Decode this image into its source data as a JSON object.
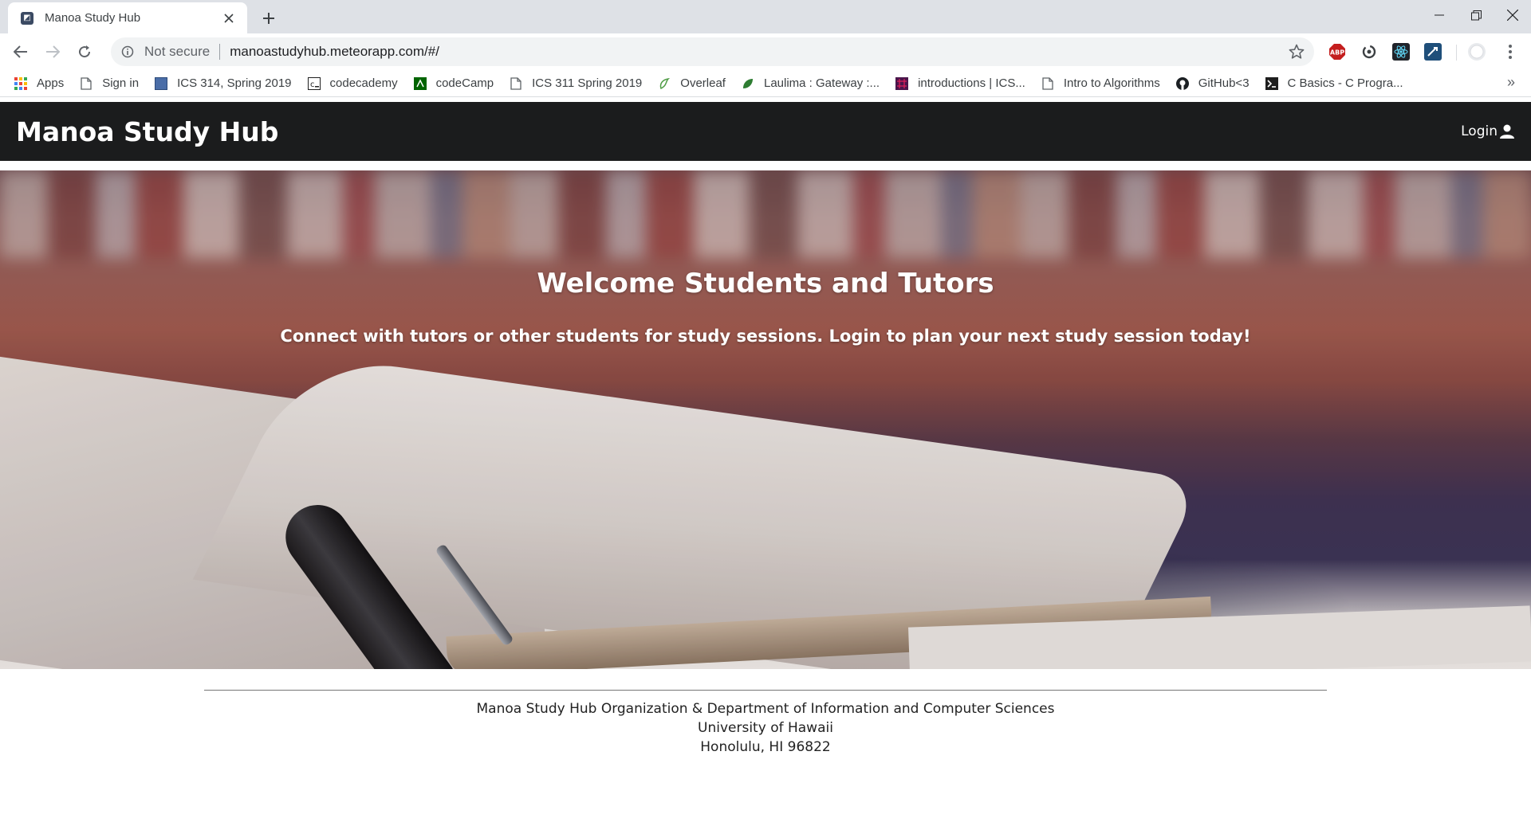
{
  "browser": {
    "tab_title": "Manoa Study Hub",
    "security_label": "Not secure",
    "url": "manoastudyhub.meteorapp.com/#/",
    "bookmarks": [
      {
        "label": "Apps",
        "icon": "apps-grid-icon"
      },
      {
        "label": "Sign in",
        "icon": "page-icon"
      },
      {
        "label": "ICS 314, Spring 2019",
        "icon": "square-blue-icon"
      },
      {
        "label": "codecademy",
        "icon": "codecademy-icon"
      },
      {
        "label": "codeCamp",
        "icon": "codecamp-icon"
      },
      {
        "label": "ICS 311 Spring 2019",
        "icon": "page-icon"
      },
      {
        "label": "Overleaf",
        "icon": "overleaf-icon"
      },
      {
        "label": "Laulima : Gateway :...",
        "icon": "laulima-icon"
      },
      {
        "label": "introductions | ICS...",
        "icon": "slack-icon"
      },
      {
        "label": "Intro to Algorithms",
        "icon": "page-icon"
      },
      {
        "label": "GitHub<3",
        "icon": "github-icon"
      },
      {
        "label": "C Basics - C Progra...",
        "icon": "terminal-icon"
      }
    ],
    "extensions": [
      "adblock-icon",
      "sync-icon",
      "react-icon",
      "extension-icon"
    ],
    "bookmarks_overflow": "»"
  },
  "site": {
    "brand": "Manoa Study Hub",
    "login_label": "Login",
    "hero_title": "Welcome Students and Tutors",
    "hero_subtitle": "Connect with tutors or other students for study sessions. Login to plan your next study session today!",
    "footer": {
      "line1": "Manoa Study Hub Organization & Department of Information and Computer Sciences",
      "line2": "University of Hawaii",
      "line3": "Honolulu, HI 96822"
    }
  },
  "colors": {
    "navbar": "#1b1c1d",
    "tabstrip": "#dee1e6",
    "omnibox": "#f1f3f4"
  }
}
